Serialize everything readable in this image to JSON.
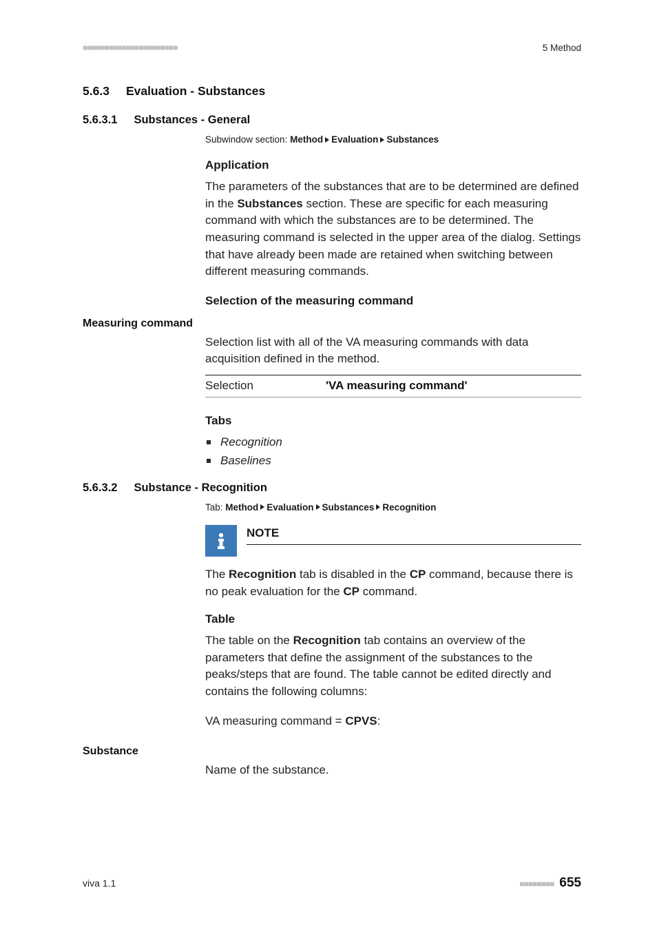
{
  "header": {
    "dashes": "■■■■■■■■■■■■■■■■■■■■■■",
    "section": "5 Method"
  },
  "sec563": {
    "num": "5.6.3",
    "title": "Evaluation - Substances"
  },
  "sec5631": {
    "num": "5.6.3.1",
    "title": "Substances - General",
    "breadcrumb_prefix": "Subwindow section: ",
    "bc": [
      "Method",
      "Evaluation",
      "Substances"
    ],
    "app_h": "Application",
    "app_p_pre": "The parameters of the substances that are to be determined are defined in the ",
    "app_bold": "Substances",
    "app_p_post": " section. These are specific for each measuring command with which the substances are to be determined. The measuring command is selected in the upper area of the dialog. Settings that have already been made are retained when switching between different measuring commands.",
    "sel_h": "Selection of the measuring command",
    "meas_label": "Measuring command",
    "meas_p": "Selection list with all of the VA measuring commands with data acquisition defined in the method.",
    "sel_k": "Selection",
    "sel_v": "'VA measuring command'",
    "tabs_h": "Tabs",
    "tabs": [
      "Recognition",
      "Baselines"
    ]
  },
  "sec5632": {
    "num": "5.6.3.2",
    "title": "Substance - Recognition",
    "breadcrumb_prefix": "Tab: ",
    "bc": [
      "Method",
      "Evaluation",
      "Substances",
      "Recognition"
    ],
    "note_title": "NOTE",
    "note_pre": "The ",
    "note_b1": "Recognition",
    "note_mid1": " tab is disabled in the ",
    "note_b2": "CP",
    "note_mid2": " command, because there is no peak evaluation for the ",
    "note_b3": "CP",
    "note_post": " command.",
    "table_h": "Table",
    "table_p_pre": "The table on the ",
    "table_b1": "Recognition",
    "table_p_post": " tab contains an overview of the parameters that define the assignment of the substances to the peaks/steps that are found. The table cannot be edited directly and contains the following columns:",
    "va_pre": "VA measuring command = ",
    "va_b": "CPVS",
    "va_post": ":",
    "substance_label": "Substance",
    "substance_p": "Name of the substance."
  },
  "footer": {
    "left": "viva 1.1",
    "dashes": "■■■■■■■■",
    "page": "655"
  }
}
